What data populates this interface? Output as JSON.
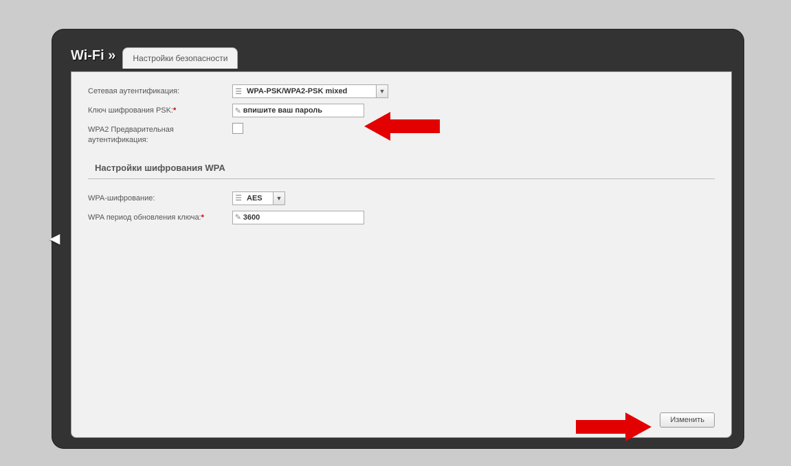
{
  "page": {
    "title": "Wi-Fi »",
    "tab": "Настройки безопасности"
  },
  "fields": {
    "auth": {
      "label": "Сетевая аутентификация:",
      "value": "WPA-PSK/WPA2-PSK mixed"
    },
    "psk": {
      "label": "Ключ шифрования PSK:",
      "required_marker": "*",
      "value": "впишите ваш пароль"
    },
    "preauth": {
      "label": "WPA2 Предварительная аутентификация:",
      "checked": false
    }
  },
  "section_wpa": {
    "title": "Настройки шифрования WPA",
    "enc": {
      "label": "WPA-шифрование:",
      "value": "AES"
    },
    "rekey": {
      "label": "WPA период обновления ключа:",
      "required_marker": "*",
      "value": "3600"
    }
  },
  "actions": {
    "save": "Изменить"
  }
}
